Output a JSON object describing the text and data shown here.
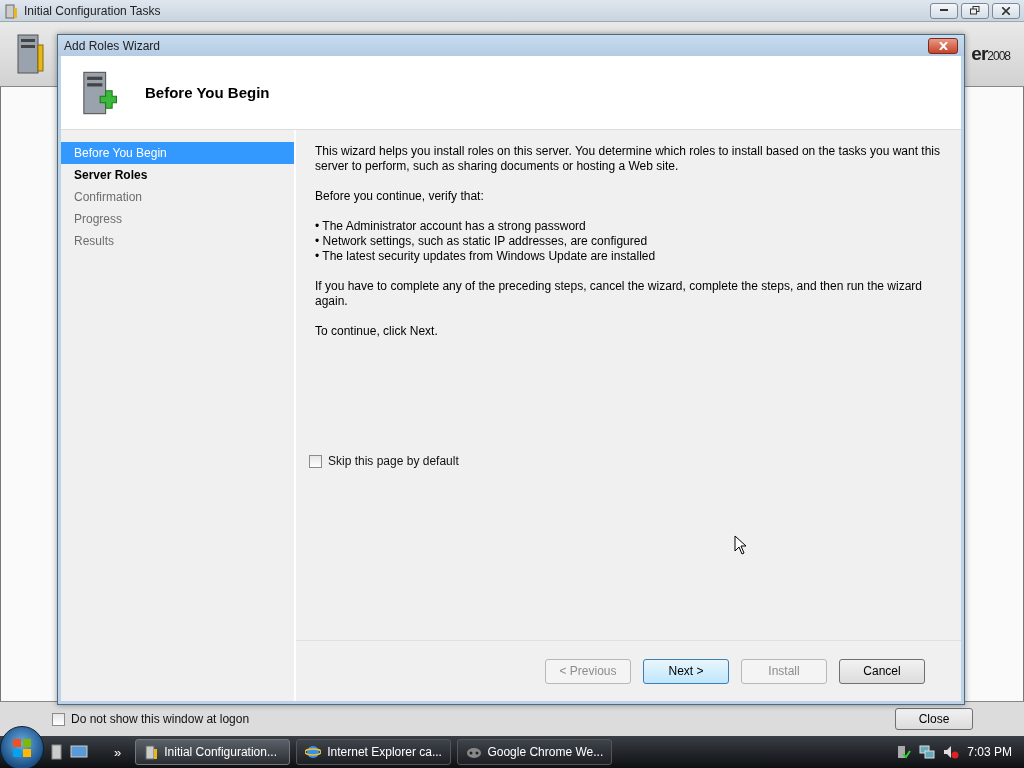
{
  "background_window": {
    "title": "Initial Configuration Tasks",
    "header_text": "er",
    "header_superscript": "2008",
    "dont_show_checkbox": {
      "label": "Do not show this window at logon",
      "checked": false
    },
    "close_button": "Close"
  },
  "wizard": {
    "title": "Add Roles Wizard",
    "heading": "Before You Begin",
    "steps": [
      {
        "label": "Before You Begin",
        "selected": true,
        "disabled": false
      },
      {
        "label": "Server Roles",
        "selected": false,
        "disabled": false
      },
      {
        "label": "Confirmation",
        "selected": false,
        "disabled": true
      },
      {
        "label": "Progress",
        "selected": false,
        "disabled": true
      },
      {
        "label": "Results",
        "selected": false,
        "disabled": true
      }
    ],
    "content": [
      {
        "kind": "paragraph",
        "text": "This wizard helps you install roles on this server. You determine which roles to install based on the tasks you want this server to perform, such as sharing documents or hosting a Web site."
      },
      {
        "kind": "paragraph",
        "text": "Before you continue, verify that:"
      },
      {
        "kind": "bullet",
        "text": "• The Administrator account has a strong password"
      },
      {
        "kind": "bullet",
        "text": "• Network settings, such as static IP addresses, are configured"
      },
      {
        "kind": "bullet",
        "text": "• The latest security updates from Windows Update are installed"
      },
      {
        "kind": "paragraph",
        "text": "If you have to complete any of the preceding steps, cancel the wizard, complete the steps, and then run the wizard again."
      },
      {
        "kind": "paragraph",
        "text": "To continue, click Next."
      }
    ],
    "skip_checkbox": {
      "label": "Skip this page by default",
      "checked": false
    },
    "buttons": [
      {
        "label": "< Previous",
        "disabled": true,
        "default": false
      },
      {
        "label": "Next >",
        "disabled": false,
        "default": true
      },
      {
        "label": "Install",
        "disabled": true,
        "default": false
      },
      {
        "label": "Cancel",
        "disabled": false,
        "default": false
      }
    ]
  },
  "taskbar": {
    "more": "»",
    "tasks": [
      {
        "label": "Initial Configuration...",
        "selected": true,
        "kind": "tools"
      },
      {
        "label": "Internet Explorer ca...",
        "selected": false,
        "kind": "ie"
      },
      {
        "label": "Google Chrome We...",
        "selected": false,
        "kind": "chrome"
      }
    ],
    "clock": "7:03 PM"
  }
}
